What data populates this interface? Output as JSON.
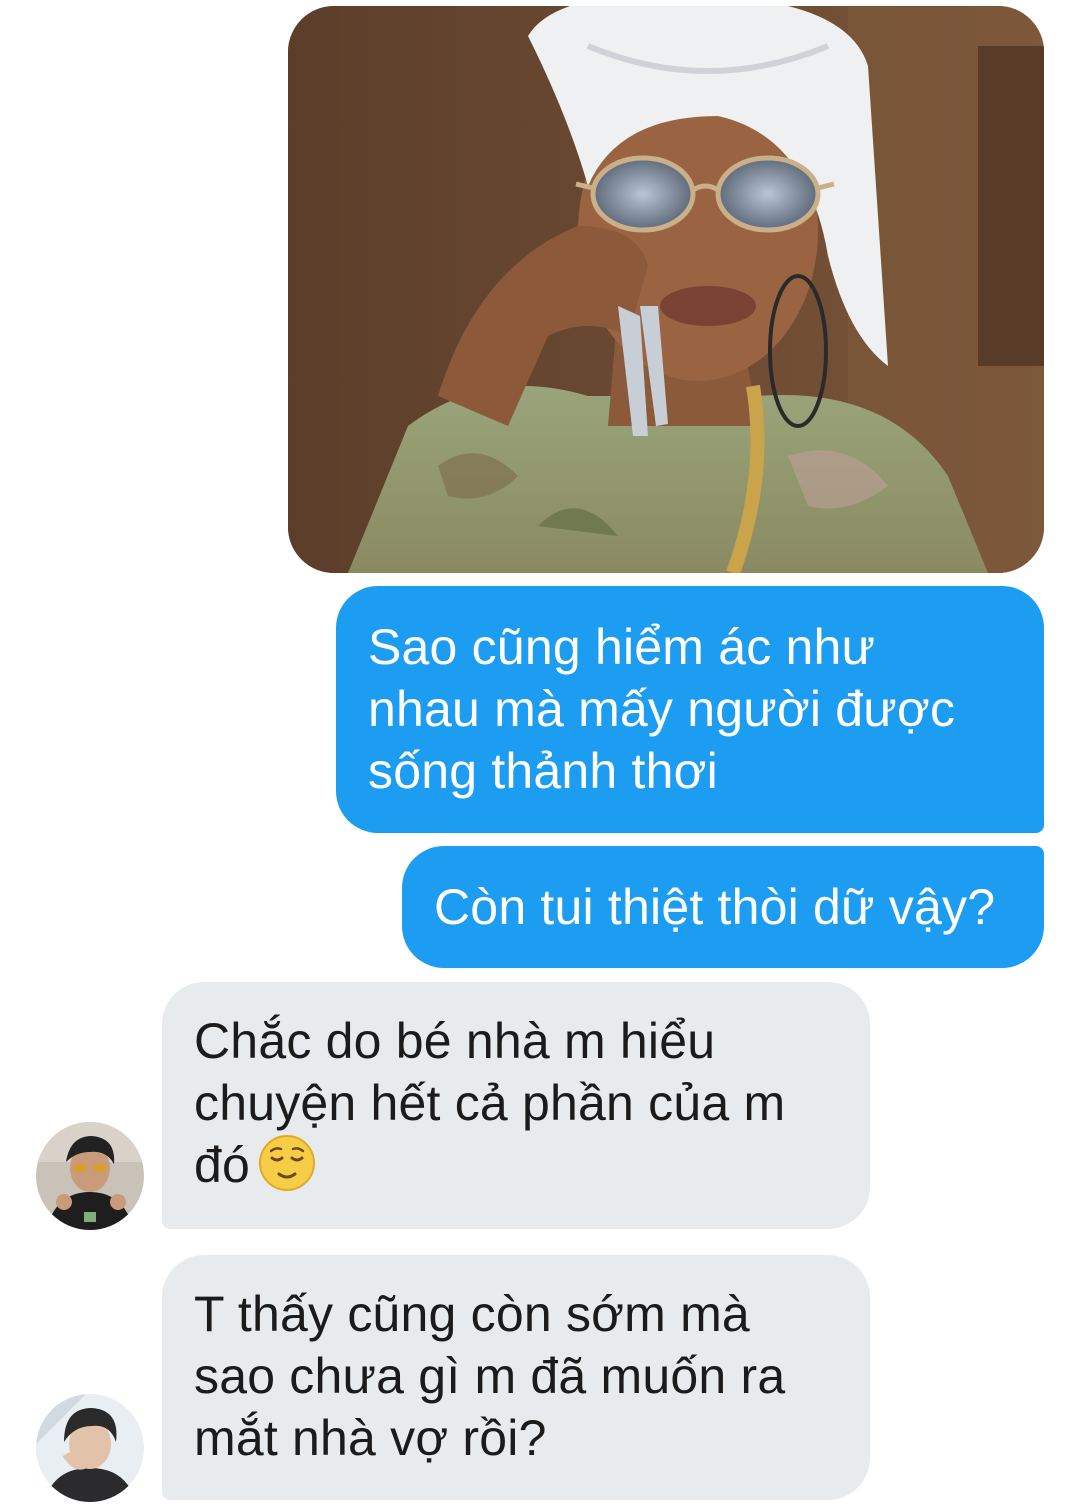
{
  "conversation": {
    "image_message": {
      "description_icon": "photo-attachment"
    },
    "outgoing": [
      {
        "lines": [
          "Sao cũng hiểm ác như",
          "nhau mà mấy người được",
          "sống thảnh thơi"
        ]
      },
      {
        "lines": [
          "Còn tui thiệt thòi dữ vậy?"
        ]
      }
    ],
    "incoming": [
      {
        "lines": [
          "Chắc do bé nhà m hiểu",
          "chuyện hết cả phần của m",
          "đó"
        ],
        "emoji": "relieved-face"
      },
      {
        "lines": [
          "T thấy cũng còn sớm mà",
          "sao chưa gì m đã muốn ra",
          "mắt nhà vợ rồi?"
        ]
      }
    ]
  },
  "colors": {
    "outgoing_bubble": "#1c9df1",
    "incoming_bubble": "#e8ebee",
    "outgoing_text": "#ffffff",
    "incoming_text": "#1b1b1b",
    "background": "#ffffff"
  }
}
